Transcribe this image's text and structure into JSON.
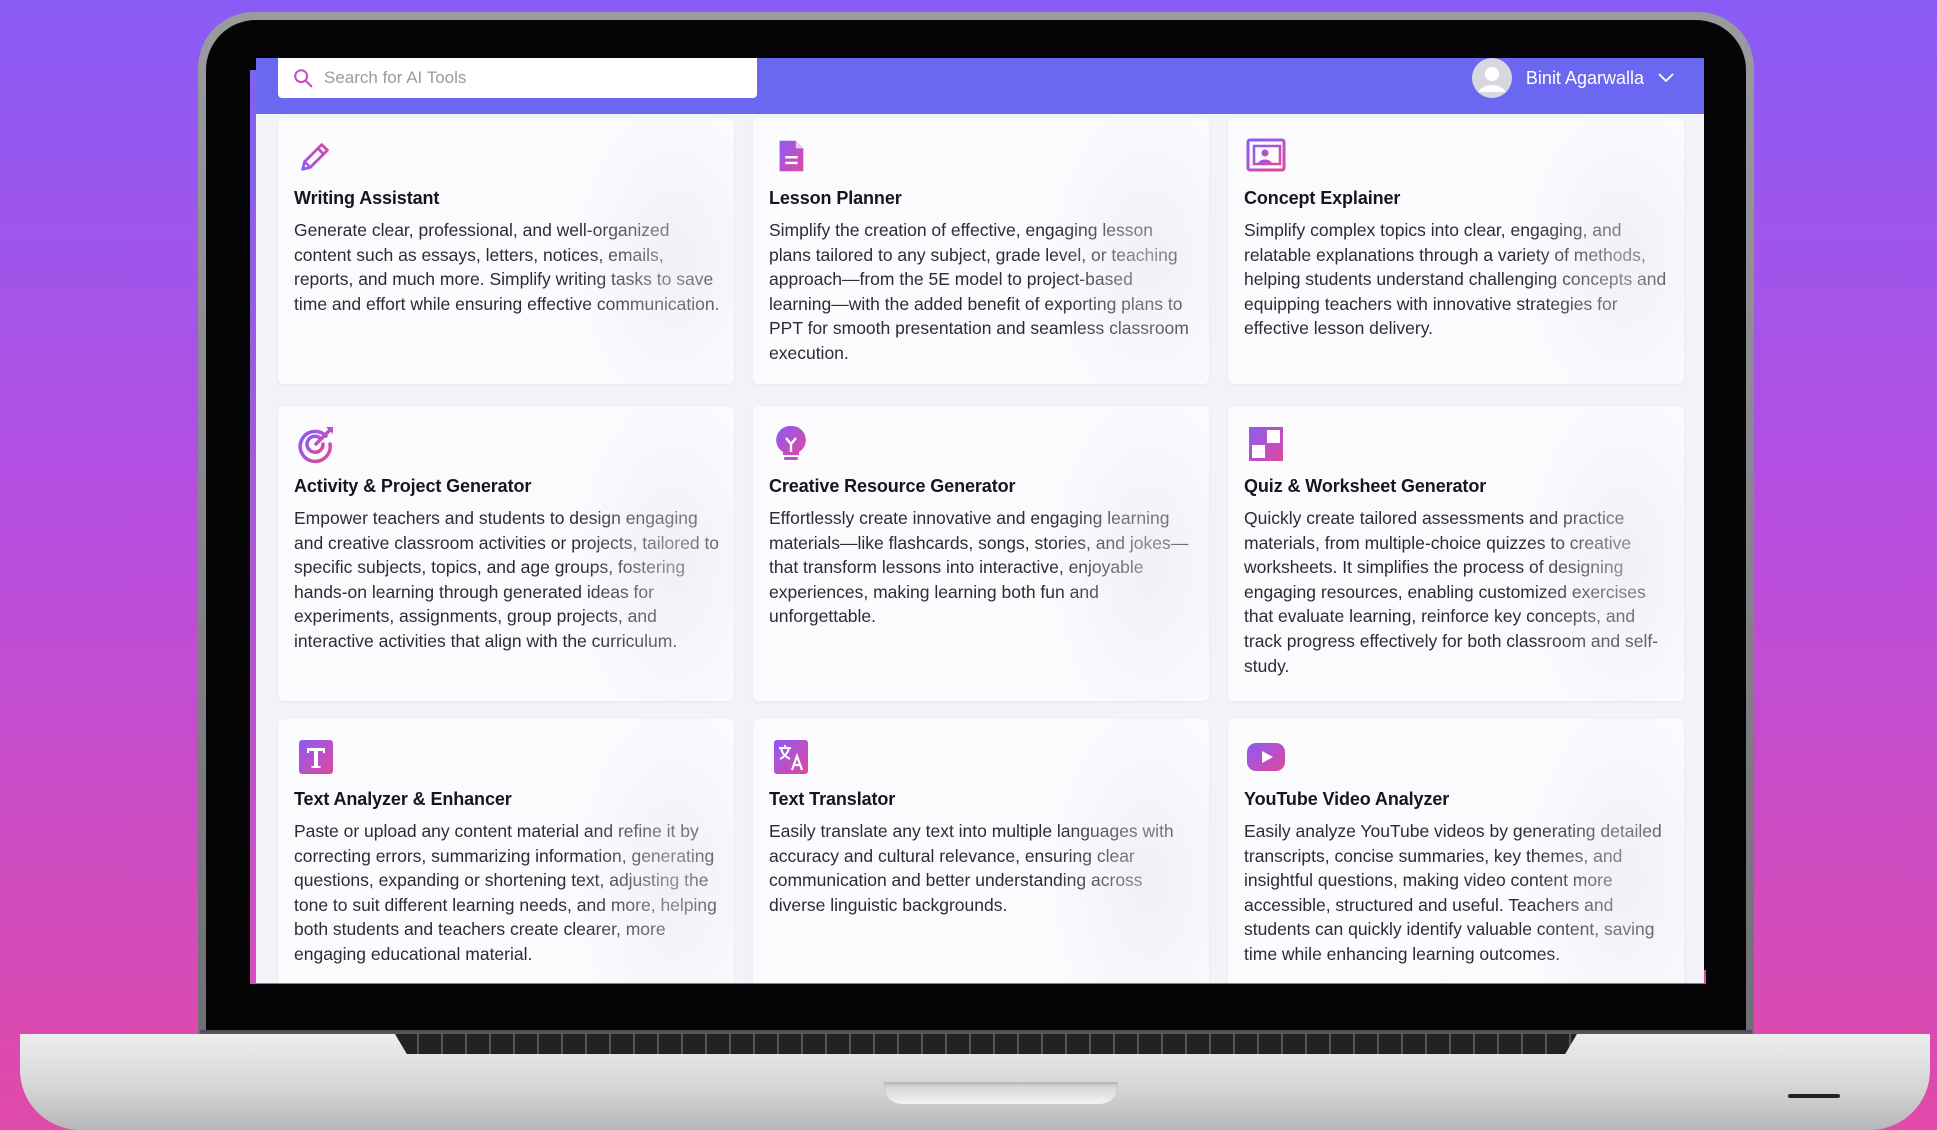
{
  "header": {
    "search_placeholder": "Search for AI Tools",
    "user_name": "Binit Agarwalla"
  },
  "colors": {
    "header_bg": "#6a67f0",
    "icon_gradient_start": "#8b5cf6",
    "icon_gradient_end": "#e0479e",
    "background_top": "#8a5cf5",
    "background_bottom": "#e14aa8"
  },
  "tools": [
    {
      "icon": "pencil-icon",
      "title": "Writing Assistant",
      "description": "Generate clear, professional, and well-organized content such as essays, letters, notices, emails, reports, and much more. Simplify writing tasks to save time and effort while ensuring effective communication."
    },
    {
      "icon": "document-icon",
      "title": "Lesson Planner",
      "description": "Simplify the creation of effective, engaging lesson plans tailored to any subject, grade level, or teaching approach—from the 5E model to project-based learning—with the added benefit of exporting plans to PPT for smooth presentation and seamless classroom execution."
    },
    {
      "icon": "presentation-icon",
      "title": "Concept Explainer",
      "description": "Simplify complex topics into clear, engaging, and relatable explanations through a variety of methods, helping students understand challenging concepts and equipping teachers with innovative strategies for effective lesson delivery."
    },
    {
      "icon": "target-icon",
      "title": "Activity & Project Generator",
      "description": "Empower teachers and students to design engaging and creative classroom activities or projects, tailored to specific subjects, topics, and age groups, fostering hands-on learning through generated ideas for experiments, assignments, group projects, and interactive activities that align with the curriculum."
    },
    {
      "icon": "lightbulb-icon",
      "title": "Creative Resource Generator",
      "description": "Effortlessly create innovative and engaging learning materials—like flashcards, songs, stories, and jokes—that transform lessons into interactive, enjoyable experiences, making learning both fun and unforgettable."
    },
    {
      "icon": "quiz-grid-icon",
      "title": "Quiz & Worksheet Generator",
      "description": "Quickly create tailored assessments and practice materials, from multiple-choice quizzes to creative worksheets. It simplifies the process of designing engaging resources, enabling customized exercises that evaluate learning, reinforce key concepts, and track progress effectively for both classroom and self-study."
    },
    {
      "icon": "text-t-icon",
      "title": "Text Analyzer & Enhancer",
      "description": "Paste or upload any content material and refine it by correcting errors, summarizing information, generating questions, expanding or shortening text, adjusting the tone to suit different learning needs, and more, helping both students and teachers create clearer, more engaging educational material."
    },
    {
      "icon": "translate-icon",
      "title": "Text Translator",
      "description": "Easily translate any text into multiple languages with accuracy and cultural relevance, ensuring clear communication and better understanding across diverse linguistic backgrounds."
    },
    {
      "icon": "youtube-play-icon",
      "title": "YouTube Video Analyzer",
      "description": "Easily analyze YouTube videos by generating detailed transcripts, concise summaries, key themes, and insightful questions, making video content more accessible, structured and useful. Teachers and students can quickly identify valuable content, saving time while enhancing learning outcomes."
    }
  ]
}
